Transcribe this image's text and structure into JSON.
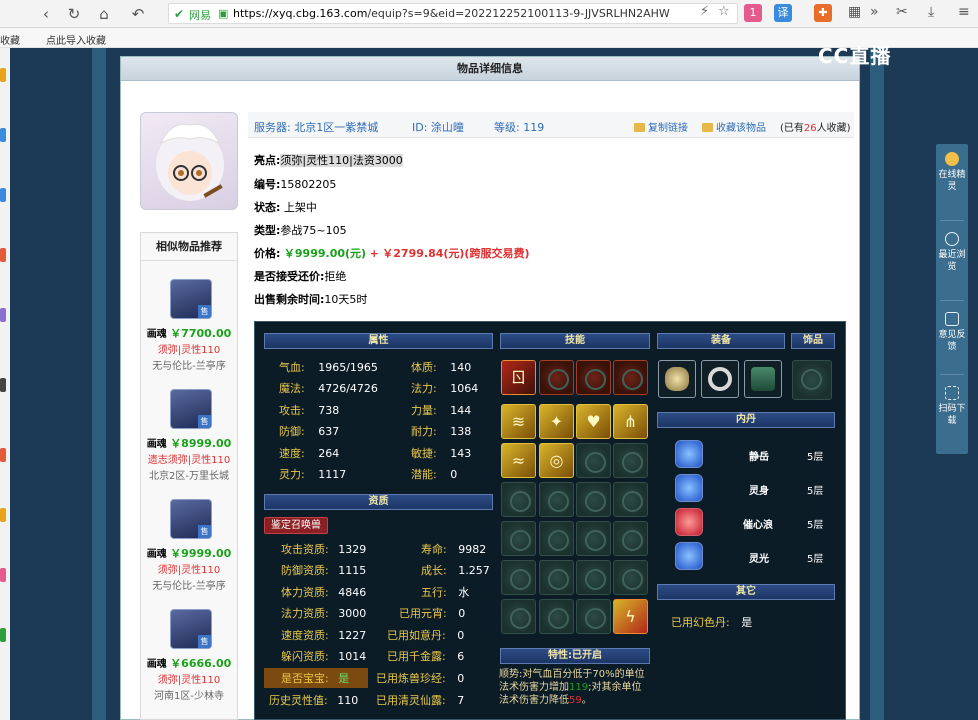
{
  "browser": {
    "url_safe": "网易",
    "url_domain": "https://xyq.cbg.163.com",
    "url_path": "/equip?s=9&eid=202212252100113-9-JJVSRLHN2AHW",
    "ext_badge": "1",
    "ext_translate": "译",
    "bookmarks": [
      "收藏",
      "点此导入收藏"
    ]
  },
  "watermark": "CC直播",
  "panel": {
    "title": "物品详细信息"
  },
  "header": {
    "server_label": "服务器:",
    "server": "北京1区一紫禁城",
    "id_label": "ID:",
    "id": "涂山曈",
    "level_label": "等级:",
    "level": "119",
    "copy_link": "复制链接",
    "favorite": "收藏该物品",
    "fav_prefix": "(已有",
    "fav_count": "26",
    "fav_suffix": "人收藏)"
  },
  "details": {
    "highlight_label": "亮点:",
    "highlight": "须弥|灵性110|法资3000",
    "serial_label": "编号:",
    "serial": "15802205",
    "status_label": "状态:",
    "status": "上架中",
    "type_label": "类型:",
    "type": "参战75~105",
    "price_label": "价格:",
    "price": "￥9999.00(元)",
    "price_plus": "+",
    "price_extra": "￥2799.84(元)(跨服交易费)",
    "bargain_label": "是否接受还价:",
    "bargain": "拒绝",
    "remaining_label": "出售剩余时间:",
    "remaining": "10天5时"
  },
  "similar": {
    "title": "相似物品推荐",
    "items": [
      {
        "kind": "画魂",
        "price": "￥7700.00",
        "tags": "须弥|灵性110",
        "server": "无与伦比-兰亭序"
      },
      {
        "kind": "画魂",
        "price": "￥8999.00",
        "tags": "遗志须弥|灵性110",
        "server": "北京2区-万里长城"
      },
      {
        "kind": "画魂",
        "price": "￥9999.00",
        "tags": "须弥|灵性110",
        "server": "无与伦比-兰亭序"
      },
      {
        "kind": "画魂",
        "price": "￥6666.00",
        "tags": "须弥|灵性110",
        "server": "河南1区-少林寺"
      }
    ],
    "sale_tag": "售"
  },
  "attributes": {
    "title": "属性",
    "left": [
      {
        "k": "气血:",
        "v": "1965/1965"
      },
      {
        "k": "魔法:",
        "v": "4726/4726"
      },
      {
        "k": "攻击:",
        "v": "738"
      },
      {
        "k": "防御:",
        "v": "637"
      },
      {
        "k": "速度:",
        "v": "264"
      },
      {
        "k": "灵力:",
        "v": "1117"
      }
    ],
    "right": [
      {
        "k": "体质:",
        "v": "140"
      },
      {
        "k": "法力:",
        "v": "1064"
      },
      {
        "k": "力量:",
        "v": "144"
      },
      {
        "k": "耐力:",
        "v": "138"
      },
      {
        "k": "敏捷:",
        "v": "143"
      },
      {
        "k": "潜能:",
        "v": "0"
      }
    ]
  },
  "aptitude": {
    "title": "资质",
    "summon_button": "鉴定召唤兽",
    "left": [
      {
        "k": "攻击资质:",
        "v": "1329"
      },
      {
        "k": "防御资质:",
        "v": "1115"
      },
      {
        "k": "体力资质:",
        "v": "4846"
      },
      {
        "k": "法力资质:",
        "v": "3000"
      },
      {
        "k": "速度资质:",
        "v": "1227"
      },
      {
        "k": "躲闪资质:",
        "v": "1014"
      },
      {
        "k": "是否宝宝:",
        "v": "是"
      },
      {
        "k": "历史灵性值:",
        "v": "110"
      }
    ],
    "right": [
      {
        "k": "寿命:",
        "v": "9982"
      },
      {
        "k": "成长:",
        "v": "1.257"
      },
      {
        "k": "五行:",
        "v": "水"
      },
      {
        "k": "已用元宵:",
        "v": "0"
      },
      {
        "k": "已用如意丹:",
        "v": "0"
      },
      {
        "k": "已用千金露:",
        "v": "6"
      },
      {
        "k": "已用炼兽珍经:",
        "v": "0"
      },
      {
        "k": "已用清灵仙露:",
        "v": "7"
      }
    ]
  },
  "skills": {
    "title": "技能",
    "feature_title": "特性:已开启",
    "feature_a": "顺势:对气血百分低于70%的单位法术伤害力增加",
    "feature_n": "119",
    "feature_b": ";对其余单位法术伤害力降低",
    "feature_m": "59",
    "feature_c": "。"
  },
  "equipment": {
    "title": "装备",
    "ornament_title": "饰品"
  },
  "inner_core": {
    "title": "内丹",
    "items": [
      {
        "name": "静岳",
        "level": "5层",
        "color": "#2c6de8"
      },
      {
        "name": "灵身",
        "level": "5层",
        "color": "#2c6de8"
      },
      {
        "name": "催心浪",
        "level": "5层",
        "color": "#d02a38"
      },
      {
        "name": "灵光",
        "level": "5层",
        "color": "#2c6de8"
      }
    ]
  },
  "other": {
    "title": "其它",
    "k": "已用幻色丹:",
    "v": "是"
  },
  "sidetool": [
    {
      "label": "在线精灵"
    },
    {
      "label": "最近浏览"
    },
    {
      "label": "意见反馈"
    },
    {
      "label": "扫码下载"
    }
  ]
}
